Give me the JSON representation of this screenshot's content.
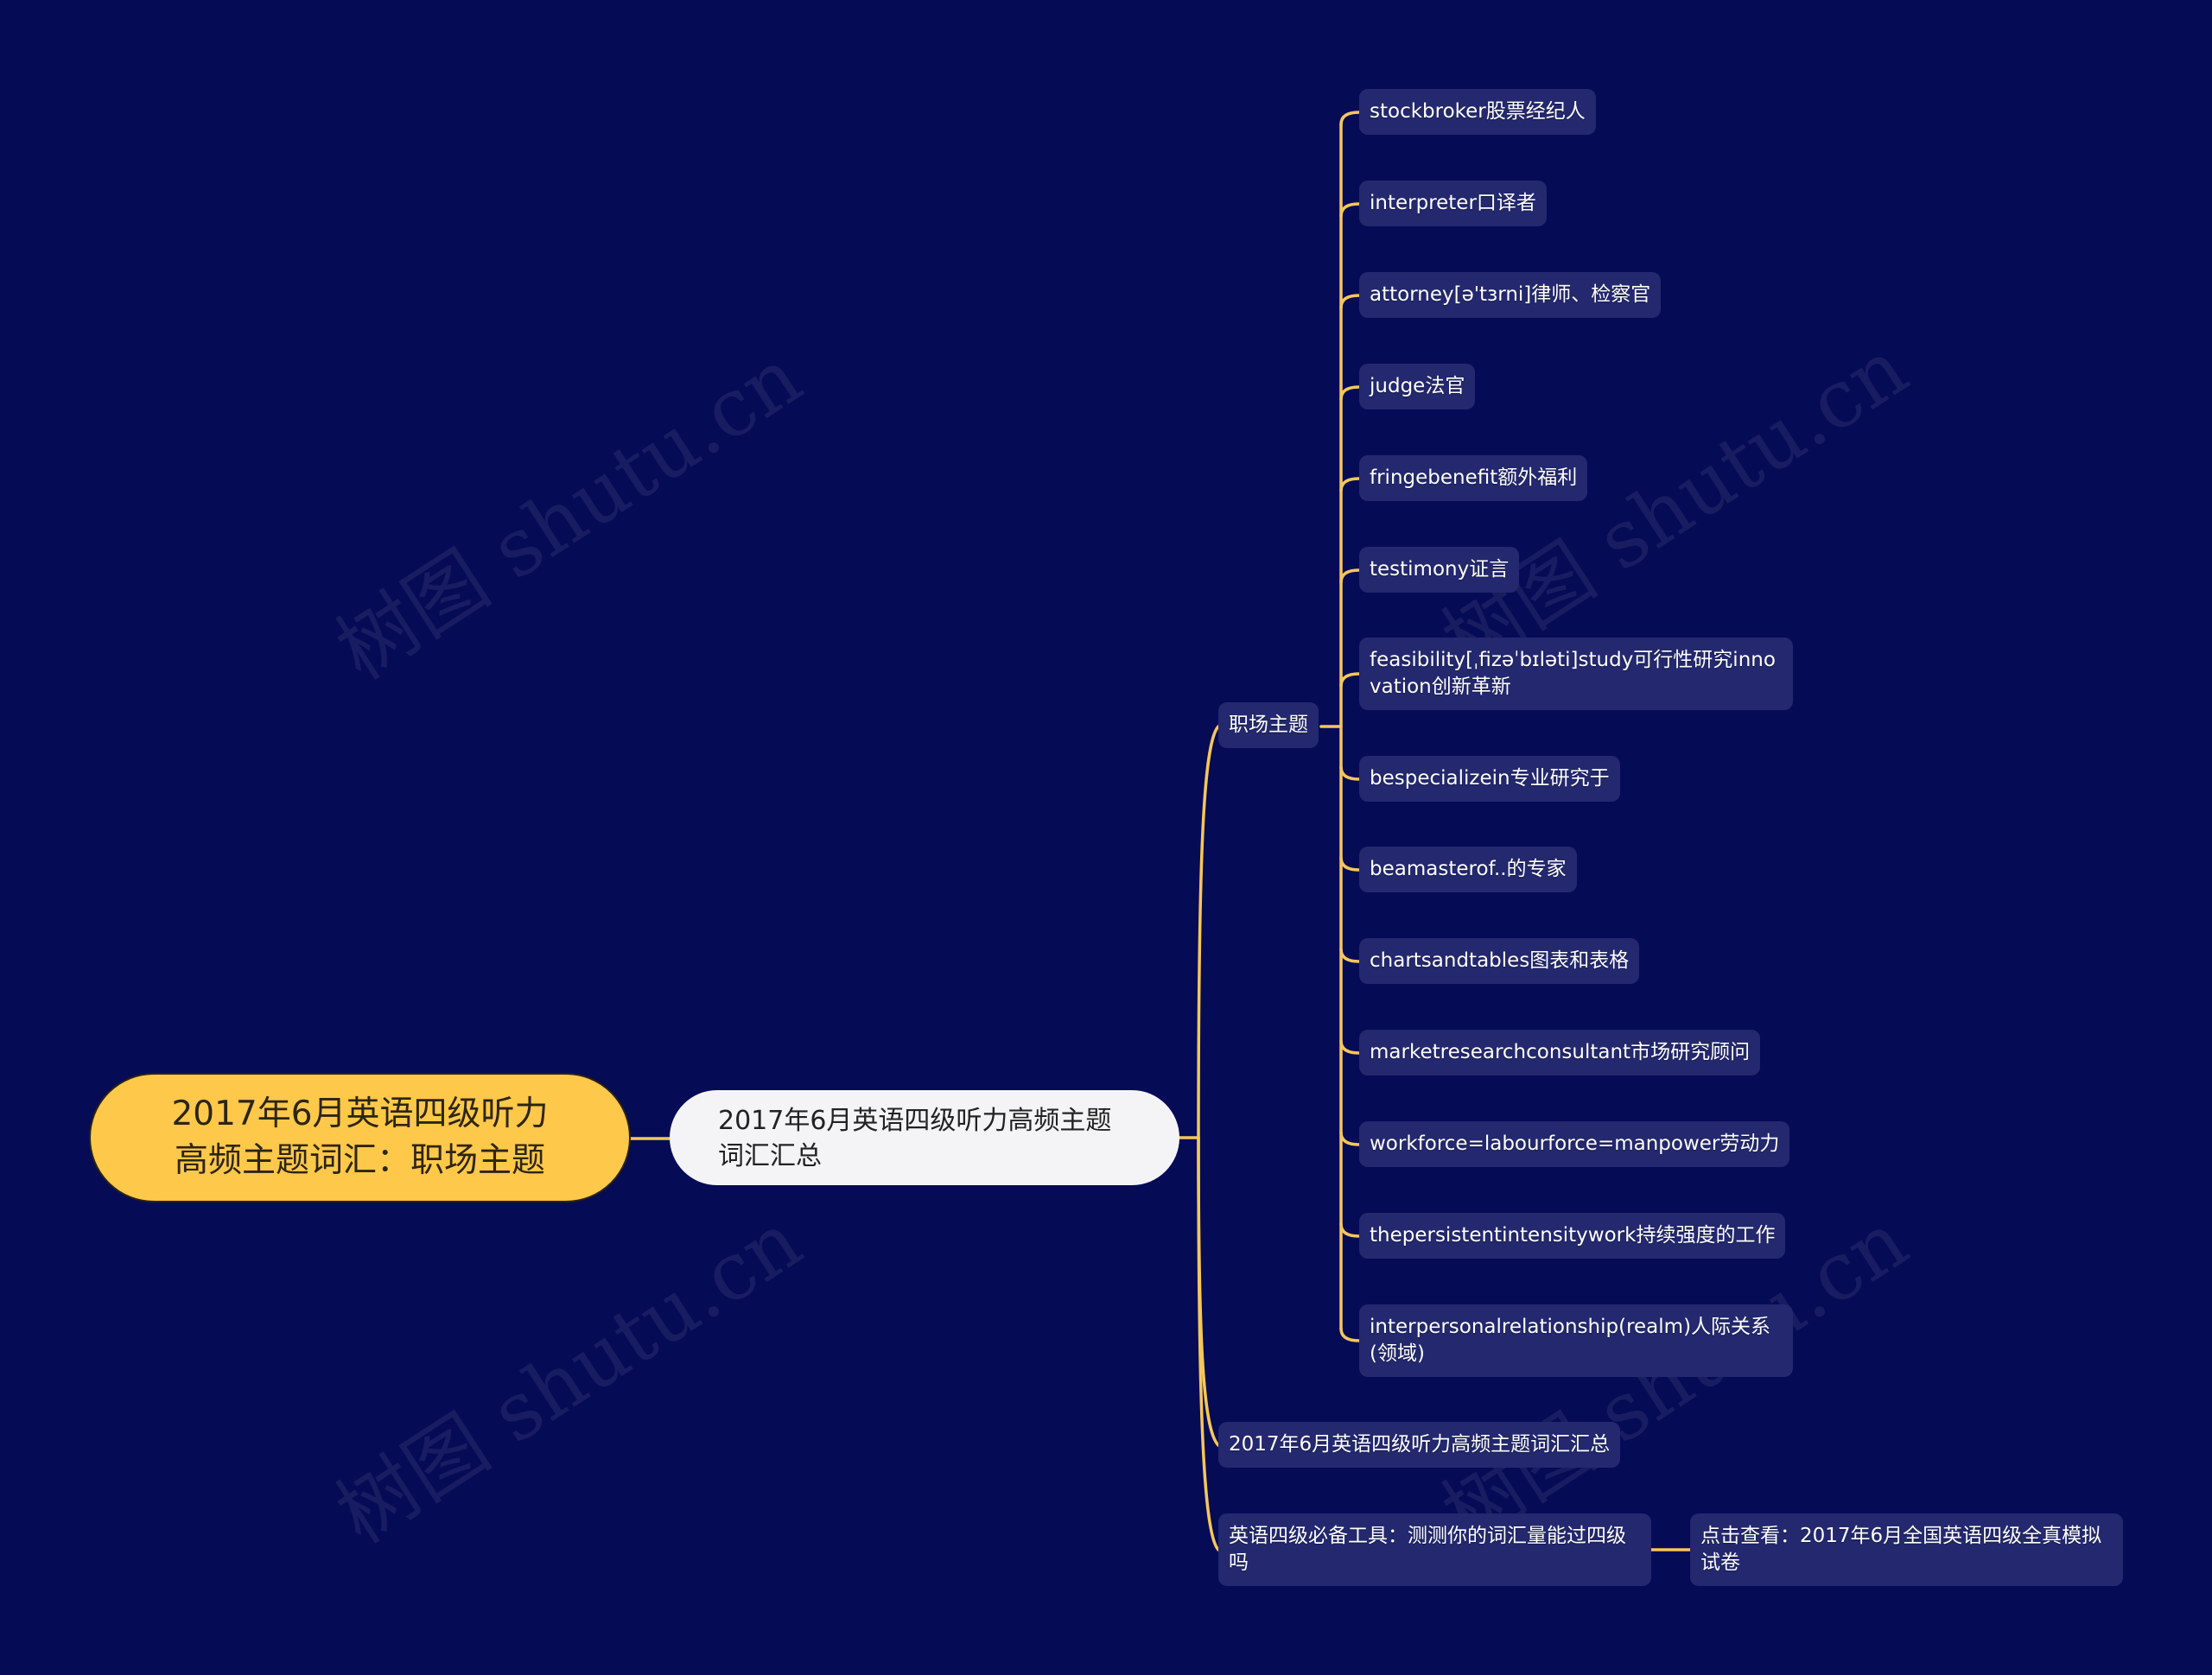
{
  "watermark": "树图 shutu.cn",
  "colors": {
    "background": "#060B56",
    "root_fill": "#FEC84A",
    "center_fill": "#F4F4F6",
    "node_fill": "#23286F",
    "link": "#F5C75A"
  },
  "mindmap": {
    "root": {
      "label": "2017年6月英语四级听力高频主题词汇：职场主题"
    },
    "center": {
      "label": "2017年6月英语四级听力高频主题词汇汇总"
    },
    "branches": [
      {
        "label": "职场主题",
        "children": [
          {
            "label": "stockbroker股票经纪人"
          },
          {
            "label": "interpreter口译者"
          },
          {
            "label": "attorney[ə'tɜrni]律师、检察官"
          },
          {
            "label": "judge法官"
          },
          {
            "label": "fringebenefit额外福利"
          },
          {
            "label": "testimony证言"
          },
          {
            "label": "feasibility[ˌfizəˈbɪləti]study可行性研究innovation创新革新"
          },
          {
            "label": "bespecializein专业研究于"
          },
          {
            "label": "beamasterof..的专家"
          },
          {
            "label": "chartsandtables图表和表格"
          },
          {
            "label": "marketresearchconsultant市场研究顾问"
          },
          {
            "label": "workforce=labourforce=manpower劳动力"
          },
          {
            "label": "thepersistentintensitywork持续强度的工作"
          },
          {
            "label": "interpersonalrelationship(realm)人际关系(领域)"
          }
        ]
      },
      {
        "label": "2017年6月英语四级听力高频主题词汇汇总",
        "children": []
      },
      {
        "label": "英语四级必备工具：测测你的词汇量能过四级吗",
        "children": [
          {
            "label": "点击查看：2017年6月全国英语四级全真模拟试卷"
          }
        ]
      }
    ]
  }
}
